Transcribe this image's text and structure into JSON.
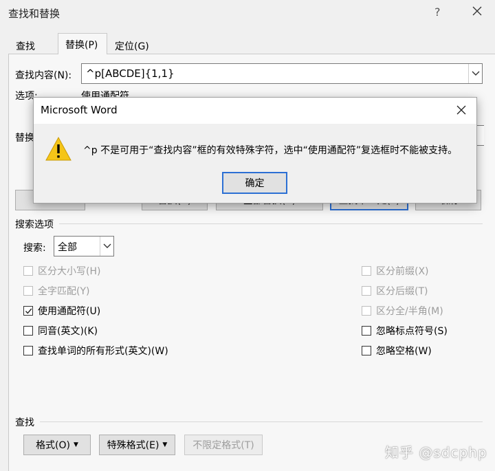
{
  "window": {
    "title": "查找和替换",
    "help": "?"
  },
  "tabs": [
    {
      "label": "查找(D)",
      "active": false
    },
    {
      "label": "替换(P)",
      "active": true
    },
    {
      "label": "定位(G)",
      "active": false
    }
  ],
  "find": {
    "label": "查找内容(N):",
    "value": "^p[ABCDE]{1,1}",
    "options_label": "选项:",
    "options_value": "使用通配符",
    "replace_label": "替换"
  },
  "buttons": {
    "more": "<",
    "replace": "替换(R)",
    "replace_all": "全部替换(A)",
    "find_next": "查找下一处(F)",
    "cancel": "取消"
  },
  "search_options": {
    "title": "搜索选项",
    "search_label": "搜索:",
    "search_value": "全部",
    "left_checks": [
      {
        "label": "区分大小写(H)",
        "checked": false,
        "disabled": true
      },
      {
        "label": "全字匹配(Y)",
        "checked": false,
        "disabled": true
      },
      {
        "label": "使用通配符(U)",
        "checked": true,
        "disabled": false
      },
      {
        "label": "同音(英文)(K)",
        "checked": false,
        "disabled": false
      },
      {
        "label": "查找单词的所有形式(英文)(W)",
        "checked": false,
        "disabled": false
      }
    ],
    "right_checks": [
      {
        "label": "区分前缀(X)",
        "checked": false,
        "disabled": true
      },
      {
        "label": "区分后缀(T)",
        "checked": false,
        "disabled": true
      },
      {
        "label": "区分全/半角(M)",
        "checked": false,
        "disabled": true
      },
      {
        "label": "忽略标点符号(S)",
        "checked": false,
        "disabled": false
      },
      {
        "label": "忽略空格(W)",
        "checked": false,
        "disabled": false
      }
    ]
  },
  "find_section": {
    "title": "查找",
    "format_btn": "格式(O)",
    "special_btn": "特殊格式(E)",
    "no_format_btn": "不限定格式(T)"
  },
  "dialog": {
    "title": "Microsoft Word",
    "message": "^p 不是可用于“查找内容”框的有效特殊字符，选中“使用通配符”复选框时不能被支持。",
    "ok": "确定"
  },
  "watermark": "知乎 @sdcphp",
  "colors": {
    "focus_border": "#2b6fd4",
    "warning_yellow": "#f5c518"
  }
}
